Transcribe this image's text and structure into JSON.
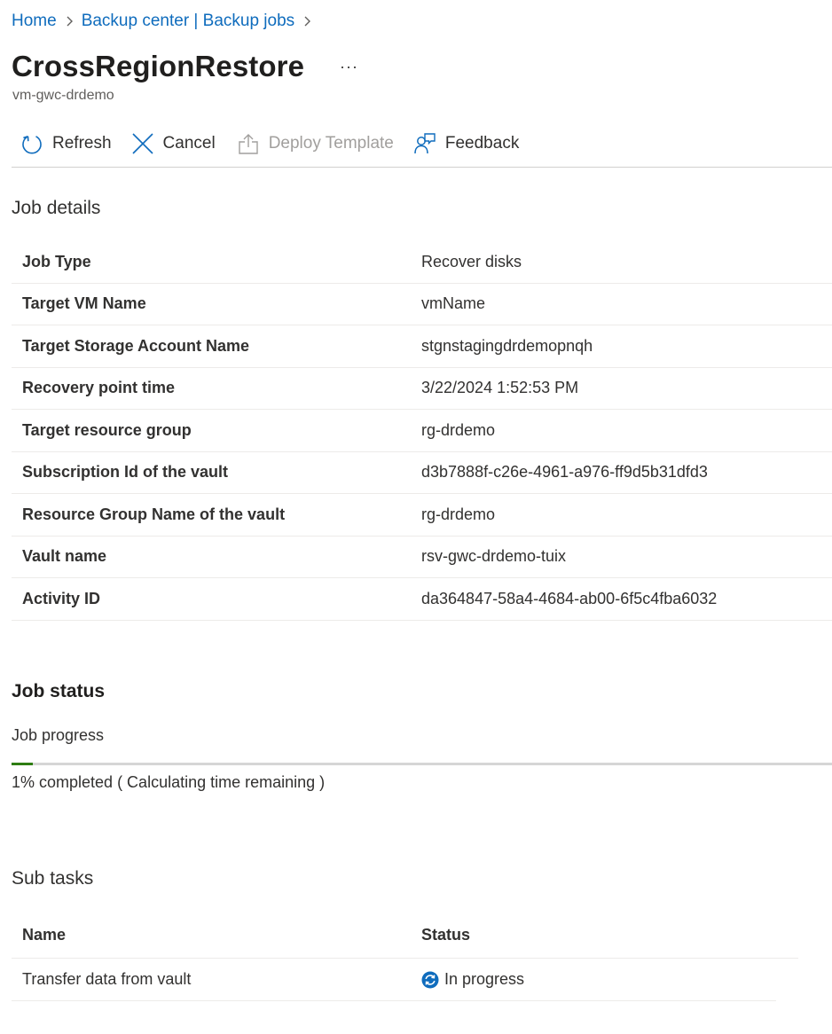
{
  "breadcrumb": {
    "items": [
      "Home",
      "Backup center | Backup jobs"
    ]
  },
  "header": {
    "title": "CrossRegionRestore",
    "more_label": "···",
    "subtitle": "vm-gwc-drdemo"
  },
  "toolbar": {
    "refresh_label": "Refresh",
    "cancel_label": "Cancel",
    "deploy_label": "Deploy Template",
    "feedback_label": "Feedback"
  },
  "job_details": {
    "heading": "Job details",
    "rows": [
      {
        "label": "Job Type",
        "value": "Recover disks"
      },
      {
        "label": "Target VM Name",
        "value": "vmName"
      },
      {
        "label": "Target Storage Account Name",
        "value": "stgnstagingdrdemopnqh"
      },
      {
        "label": "Recovery point time",
        "value": "3/22/2024 1:52:53 PM"
      },
      {
        "label": "Target resource group",
        "value": "rg-drdemo"
      },
      {
        "label": "Subscription Id of the vault",
        "value": "d3b7888f-c26e-4961-a976-ff9d5b31dfd3"
      },
      {
        "label": "Resource Group Name of the vault",
        "value": "rg-drdemo"
      },
      {
        "label": "Vault name",
        "value": "rsv-gwc-drdemo-tuix"
      },
      {
        "label": "Activity ID",
        "value": "da364847-58a4-4684-ab00-6f5c4fba6032"
      }
    ]
  },
  "job_status": {
    "heading": "Job status",
    "progress_label": "Job progress",
    "progress_percent": 1,
    "progress_text": "1% completed ( Calculating time remaining )",
    "progress_color": "#2e7d12"
  },
  "sub_tasks": {
    "heading": "Sub tasks",
    "columns": [
      "Name",
      "Status"
    ],
    "rows": [
      {
        "name": "Transfer data from vault",
        "status": "In progress",
        "status_icon": "sync-icon"
      }
    ]
  },
  "colors": {
    "link": "#0f6cbd",
    "status_icon": "#0f6cbd"
  }
}
